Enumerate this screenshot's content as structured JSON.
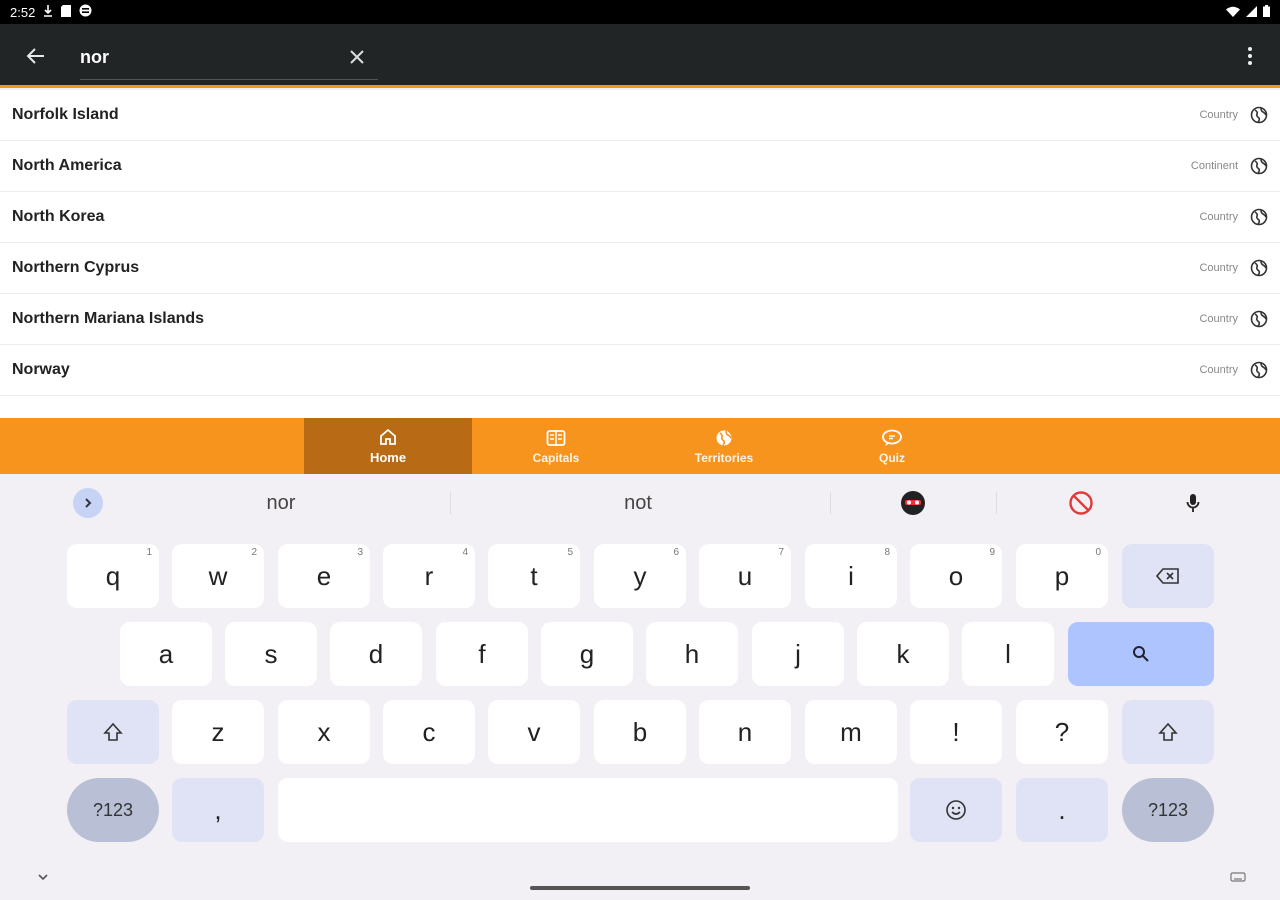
{
  "status_bar": {
    "time": "2:52"
  },
  "search": {
    "query": "nor"
  },
  "results": [
    {
      "name": "Norfolk Island",
      "type": "Country"
    },
    {
      "name": "North America",
      "type": "Continent"
    },
    {
      "name": "North Korea",
      "type": "Country"
    },
    {
      "name": "Northern Cyprus",
      "type": "Country"
    },
    {
      "name": "Northern Mariana Islands",
      "type": "Country"
    },
    {
      "name": "Norway",
      "type": "Country"
    }
  ],
  "bottom_nav": {
    "home": "Home",
    "capitals": "Capitals",
    "territories": "Territories",
    "quiz": "Quiz"
  },
  "keyboard": {
    "suggestions": [
      "nor",
      "not"
    ],
    "row1": [
      "q",
      "w",
      "e",
      "r",
      "t",
      "y",
      "u",
      "i",
      "o",
      "p"
    ],
    "row1_hints": [
      "1",
      "2",
      "3",
      "4",
      "5",
      "6",
      "7",
      "8",
      "9",
      "0"
    ],
    "row2": [
      "a",
      "s",
      "d",
      "f",
      "g",
      "h",
      "j",
      "k",
      "l"
    ],
    "row3": [
      "z",
      "x",
      "c",
      "v",
      "b",
      "n",
      "m",
      "!",
      "?"
    ],
    "symbols_label": "?123",
    "comma": ",",
    "period": "."
  },
  "colors": {
    "app_bar": "#212525",
    "accent": "#f7941d",
    "active_tab": "#b86a14",
    "key_action": "#aec4ff"
  },
  "icons": {
    "back": "arrow-left-icon",
    "clear": "close-icon",
    "overflow": "more-vert-icon",
    "result": "globe-icon",
    "home": "home-icon",
    "capitals": "book-icon",
    "territories": "globe-icon",
    "quiz": "chat-bubble-icon"
  }
}
